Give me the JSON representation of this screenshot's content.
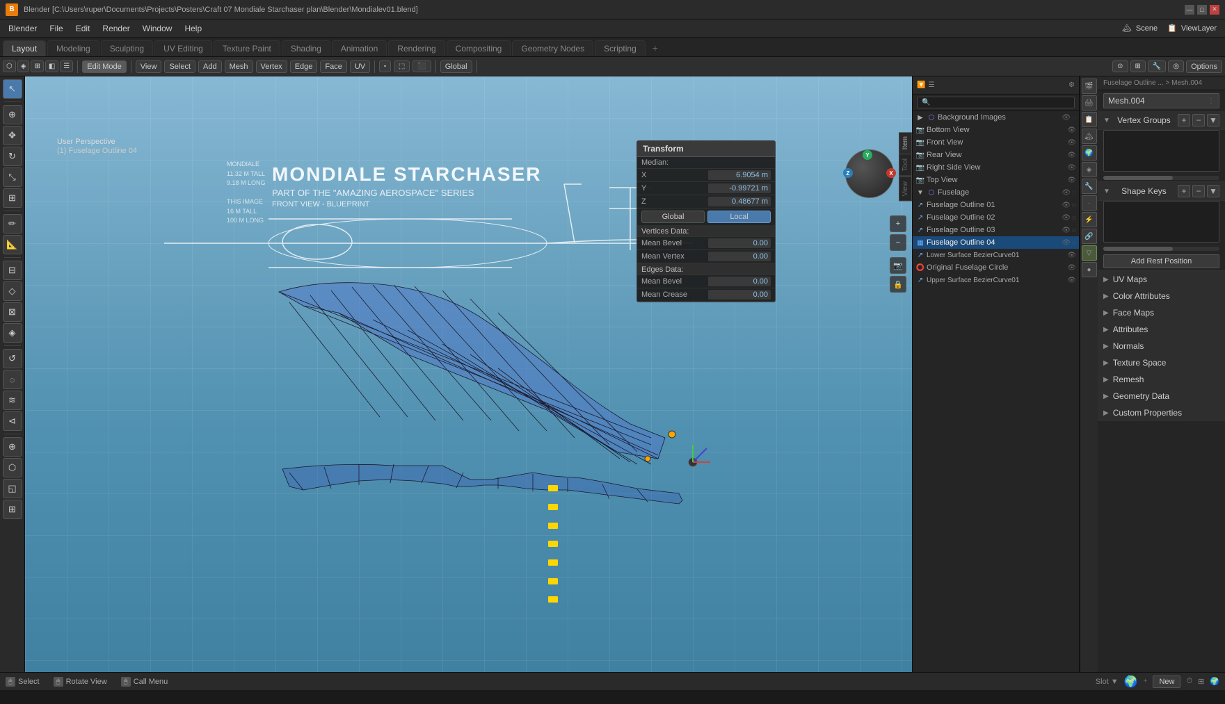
{
  "title": {
    "text": "Blender [C:\\Users\\ruper\\Documents\\Projects\\Posters\\Craft 07 Mondiale Starchaser plan\\Blender\\Mondialev01.blend]",
    "icon": "B"
  },
  "window_controls": {
    "minimize": "—",
    "maximize": "□",
    "close": "✕"
  },
  "menu": {
    "items": [
      "Blender",
      "File",
      "Edit",
      "Render",
      "Window",
      "Help"
    ]
  },
  "workspace_tabs": {
    "tabs": [
      "Layout",
      "Modeling",
      "Sculpting",
      "UV Editing",
      "Texture Paint",
      "Shading",
      "Animation",
      "Rendering",
      "Compositing",
      "Geometry Nodes",
      "Scripting"
    ],
    "active": "Layout",
    "add": "+"
  },
  "toolbar": {
    "mode": "Edit Mode",
    "view": "View",
    "select": "Select",
    "add": "Add",
    "mesh": "Mesh",
    "vertex": "Vertex",
    "edge": "Edge",
    "face": "Face",
    "uv": "UV",
    "transform": "Global",
    "options": "Options"
  },
  "viewport": {
    "perspective": "User Perspective",
    "object_name": "(1) Fuselage Outline 04",
    "blueprint": {
      "title": "MONDIALE STARCHASER",
      "subtitle": "PART OF THE \"AMAZING AEROSPACE\" SERIES",
      "view_label": "FRONT VIEW - BLUEPRINT",
      "stats": "MONDIALE\n11.32 M TALL\n9.18 M LONG\nTHIS IMAGE\n16 M TALL\n100 M LONG"
    }
  },
  "transform_panel": {
    "title": "Transform",
    "median_label": "Median:",
    "x_label": "X",
    "x_value": "6.9054 m",
    "y_label": "Y",
    "y_value": "-0.99721 m",
    "z_label": "Z",
    "z_value": "0.48677 m",
    "global_btn": "Global",
    "local_btn": "Local",
    "vertices_section": "Vertices Data:",
    "mean_bevel_v_label": "Mean Bevel",
    "mean_bevel_v_value": "0.00",
    "mean_vertex_label": "Mean Vertex",
    "mean_vertex_value": "0.00",
    "edges_section": "Edges Data:",
    "mean_bevel_e_label": "Mean Bevel",
    "mean_bevel_e_value": "0.00",
    "mean_crease_label": "Mean Crease",
    "mean_crease_value": "0.00"
  },
  "outliner": {
    "search_placeholder": "🔍",
    "items": [
      {
        "name": "Background Images",
        "type": "collection",
        "indent": 0,
        "expanded": true,
        "icon": "🗂"
      },
      {
        "name": "Bottom View",
        "type": "object",
        "indent": 1,
        "icon": "📷"
      },
      {
        "name": "Front View",
        "type": "object",
        "indent": 1,
        "icon": "📷"
      },
      {
        "name": "Rear View",
        "type": "object",
        "indent": 1,
        "icon": "📷"
      },
      {
        "name": "Right Side View",
        "type": "object",
        "indent": 1,
        "icon": "📷"
      },
      {
        "name": "Top View",
        "type": "object",
        "indent": 1,
        "icon": "📷"
      },
      {
        "name": "Fuselage",
        "type": "collection",
        "indent": 0,
        "expanded": true,
        "icon": "🗂"
      },
      {
        "name": "Fuselage Outline 01",
        "type": "object",
        "indent": 1,
        "icon": "✏"
      },
      {
        "name": "Fuselage Outline 02",
        "type": "object",
        "indent": 1,
        "icon": "✏"
      },
      {
        "name": "Fuselage Outline 03",
        "type": "object",
        "indent": 1,
        "icon": "✏"
      },
      {
        "name": "Fuselage Outline 04",
        "type": "object",
        "indent": 1,
        "icon": "✏",
        "selected": true
      },
      {
        "name": "Lower Surface BezierCurve01",
        "type": "object",
        "indent": 1,
        "icon": "✏"
      },
      {
        "name": "Original Fuselage Circle",
        "type": "object",
        "indent": 1,
        "icon": "⭕"
      },
      {
        "name": "Upper Surface BezierCurve01",
        "type": "object",
        "indent": 1,
        "icon": "✏"
      }
    ]
  },
  "properties": {
    "breadcrumb": "Fuselage Outline ... > Mesh.004",
    "mesh_name": "Mesh.004",
    "vertex_groups_title": "Vertex Groups",
    "shape_keys_title": "Shape Keys",
    "add_rest_position": "Add Rest Position",
    "uv_maps": "UV Maps",
    "color_attributes": "Color Attributes",
    "face_maps": "Face Maps",
    "attributes": "Attributes",
    "normals": "Normals",
    "texture_space": "Texture Space",
    "remesh": "Remesh",
    "geometry_data": "Geometry Data",
    "custom_properties": "Custom Properties"
  },
  "status_bar": {
    "select": "Select",
    "rotate": "Rotate View",
    "call_menu": "Call Menu"
  },
  "icons": {
    "cursor": "↖",
    "move": "✥",
    "rotate": "↻",
    "scale": "⤡",
    "transform": "⊞",
    "annotate": "✏",
    "measure": "📏",
    "add": "+",
    "camera": "📷",
    "object": "◈",
    "eye": "👁",
    "hide": "◌",
    "expand": "▶",
    "collapse": "▼",
    "check": "✓",
    "mesh": "▦",
    "material": "●",
    "modifier": "🔧",
    "particles": "·",
    "physics": "⚡",
    "constraint": "🔗",
    "data": "▽"
  }
}
